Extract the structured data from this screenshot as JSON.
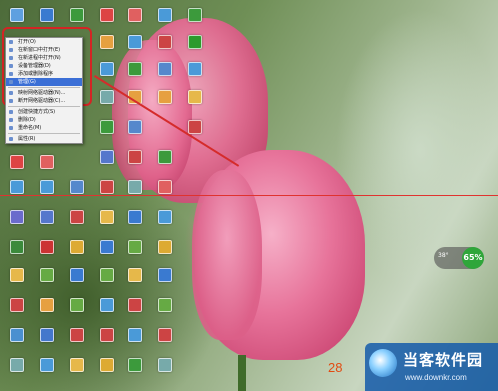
{
  "context_menu": {
    "items": [
      {
        "label": "打开(O)",
        "selected": false
      },
      {
        "label": "在新窗口中打开(E)",
        "selected": false
      },
      {
        "label": "在新进程中打开(N)",
        "selected": false
      },
      {
        "label": "设备管理器(D)",
        "selected": false
      },
      {
        "label": "添加或删除程序",
        "selected": false
      },
      {
        "label": "管理(G)",
        "selected": true
      },
      {
        "label": "映射网络驱动器(N)...",
        "selected": false
      },
      {
        "label": "断开网络驱动器(C)...",
        "selected": false
      },
      {
        "label": "创建快捷方式(S)",
        "selected": false
      },
      {
        "label": "删除(D)",
        "selected": false
      },
      {
        "label": "重命名(M)",
        "selected": false
      },
      {
        "label": "属性(R)",
        "selected": false
      }
    ]
  },
  "gadget": {
    "left_text": "38°",
    "percent": "65%"
  },
  "clock": {
    "text": "28"
  },
  "watermark": {
    "title": "当客软件园",
    "url": "www.downkr.com"
  },
  "colors": {
    "accent": "#3b6fd6",
    "highlight_red": "#d42424",
    "gadget_green": "#2fa63a"
  }
}
